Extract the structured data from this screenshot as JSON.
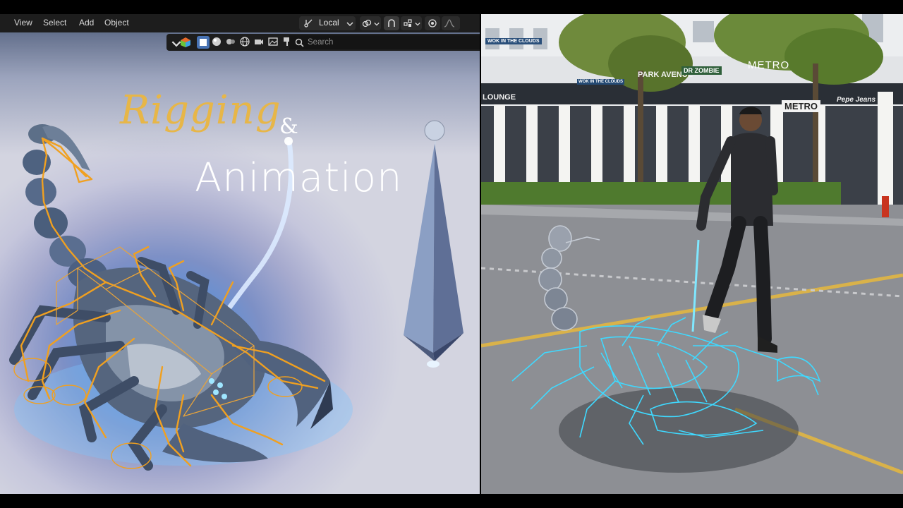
{
  "header": {
    "menu": {
      "view": "View",
      "select": "Select",
      "add": "Add",
      "object": "Object"
    },
    "transform_orientation": "Local"
  },
  "toolbar": {
    "search": {
      "placeholder": "Search"
    }
  },
  "viewport": {
    "title_line_1": "Rigging",
    "title_ampersand": "&",
    "title_line_2": "Animation"
  },
  "photo": {
    "signs": {
      "wok_top": "WOK IN THE CLOUDS",
      "wok_mid": "WOK IN THE CLOUDS",
      "park_avenue": "PARK AVENUE",
      "dr_zombie": "DR ZOMBIE",
      "metro_top": "METRO",
      "lounge": "LOUNGE",
      "metro_store": "METRO",
      "pepe_jeans": "Pepe Jeans"
    }
  },
  "colors": {
    "title_gold": "#e7b648",
    "rig_orange": "#f0a020",
    "wire_cyan": "#3fd9ff",
    "blender_header": "#1d1d1d"
  },
  "icons": [
    "transform-orientation-icon",
    "chevron-down-icon",
    "link-icon",
    "snap-icon",
    "snap-increment-icon",
    "proportional-edit-icon",
    "falloff-icon",
    "object-mode-color-icon",
    "select-box-icon",
    "search-icon"
  ]
}
